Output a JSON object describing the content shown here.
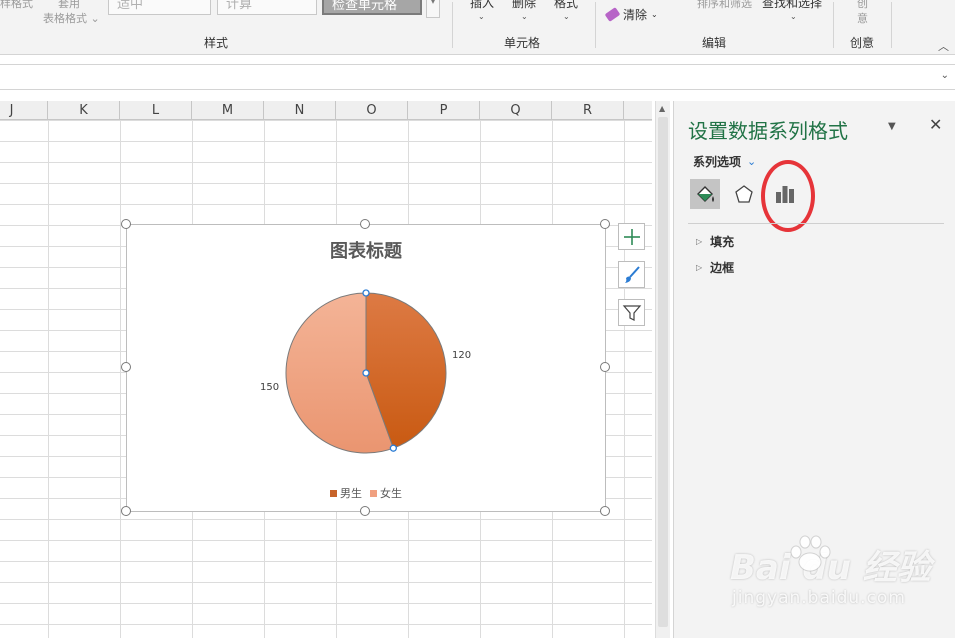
{
  "ribbon": {
    "faded_top_left": "样格式",
    "table_format_top": "套用",
    "table_format": "表格格式",
    "style_boxes": [
      "适中",
      "计算",
      "检查单元格"
    ],
    "groups": {
      "styles": "样式",
      "cells": "单元格",
      "editing": "编辑",
      "creativity": "创意"
    },
    "cells_buttons": [
      "插入",
      "删除",
      "格式"
    ],
    "clear_label": "清除",
    "sort_filter": "排序和筛选",
    "find_select": "查找和选择",
    "create_btn_top": "创",
    "create_btn_bottom": "意"
  },
  "columns": [
    "J",
    "K",
    "L",
    "M",
    "N",
    "O",
    "P",
    "Q",
    "R"
  ],
  "chart_data": {
    "type": "pie",
    "title": "图表标题",
    "categories": [
      "男生",
      "女生"
    ],
    "values": [
      120,
      150
    ],
    "colors": [
      "#d46a2a",
      "#f0a080"
    ],
    "data_labels": [
      "120",
      "150"
    ],
    "legend_position": "bottom"
  },
  "chart_tools": [
    "plus-icon",
    "brush-icon",
    "filter-icon"
  ],
  "format_pane": {
    "title": "设置数据系列格式",
    "series_options": "系列选项",
    "tabs": [
      "fill-line-icon",
      "effects-icon",
      "series-options-icon"
    ],
    "sections": [
      "填充",
      "边框"
    ]
  },
  "watermark": {
    "main": "Bai du 经验",
    "sub": "jingyan.baidu.com"
  }
}
